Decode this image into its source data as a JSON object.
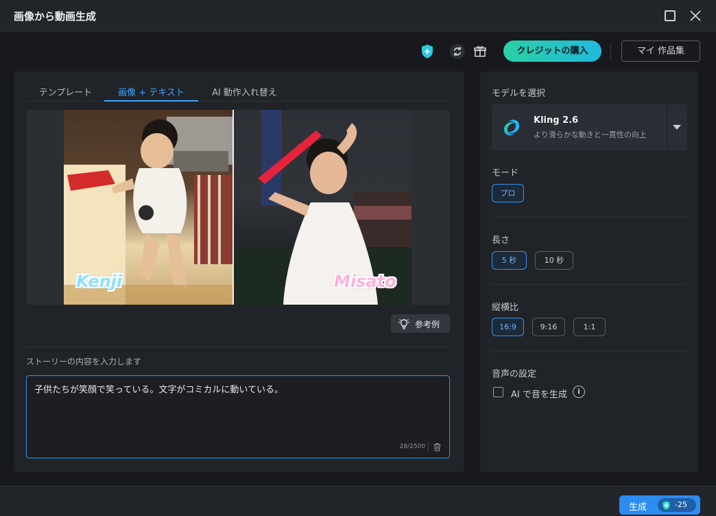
{
  "window": {
    "title": "画像から動画生成"
  },
  "topbar": {
    "buy_credits_label": "クレジットの購入",
    "my_works_label": "マイ 作品集",
    "icons": [
      "credit-icon",
      "refresh-icon",
      "gift-icon"
    ]
  },
  "tabs": [
    {
      "label": "テンプレート",
      "active": false
    },
    {
      "label": "画像 + テキスト",
      "active": true
    },
    {
      "label": "AI 動作入れ替え",
      "active": false
    }
  ],
  "preview": {
    "left_name": "Kenji",
    "right_name": "Misato",
    "example_label": "参考例"
  },
  "story": {
    "label": "ストーリーの内容を入力します",
    "value": "子供たちが笑顔で笑っている。文字がコミカルに動いている。",
    "char_count": "28/2500"
  },
  "settings": {
    "model_label": "モデルを選択",
    "model_name": "Kling 2.6",
    "model_desc": "より滑らかな動きと一貫性の向上",
    "mode_label": "モード",
    "mode_options": [
      {
        "label": "プロ",
        "selected": true
      }
    ],
    "length_label": "長さ",
    "length_options": [
      {
        "label": "5 秒",
        "selected": true
      },
      {
        "label": "10 秒",
        "selected": false
      }
    ],
    "aspect_label": "縦横比",
    "aspect_options": [
      {
        "label": "16:9",
        "selected": true
      },
      {
        "label": "9:16",
        "selected": false
      },
      {
        "label": "1:1",
        "selected": false
      }
    ],
    "audio_label": "音声の設定",
    "audio_checkbox_label": "AI で音を生成",
    "audio_checked": false
  },
  "footer": {
    "generate_label": "生成",
    "cost": "-25"
  },
  "colors": {
    "accent": "#3ea6ff",
    "primary_button": "#2d8cf0",
    "buy_gradient_start": "#2ad0a5",
    "buy_gradient_end": "#23b8dc"
  }
}
